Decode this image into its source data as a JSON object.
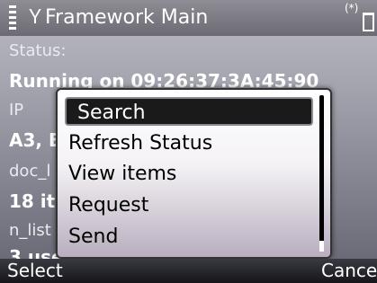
{
  "header": {
    "title": "Framework Main",
    "connection_indicator": "(*)"
  },
  "content": {
    "status_label": "Status:",
    "status_value": "Running on 09:26:37:3A:45:90",
    "ip_label": "IP",
    "ip_value": "A3, E",
    "doc_label": "doc_l",
    "doc_value": "18 it",
    "n_list_label": "n_list",
    "n_list_value": "3 use"
  },
  "menu": {
    "items": [
      {
        "label": "Search",
        "selected": true
      },
      {
        "label": "Refresh Status",
        "selected": false
      },
      {
        "label": "View items",
        "selected": false
      },
      {
        "label": "Request",
        "selected": false
      },
      {
        "label": "Send",
        "selected": false
      }
    ]
  },
  "softkeys": {
    "left": "Select",
    "right": "Cance"
  },
  "icons": {
    "signal": "signal-strength-icon",
    "antenna": "antenna-icon",
    "battery": "battery-icon"
  }
}
